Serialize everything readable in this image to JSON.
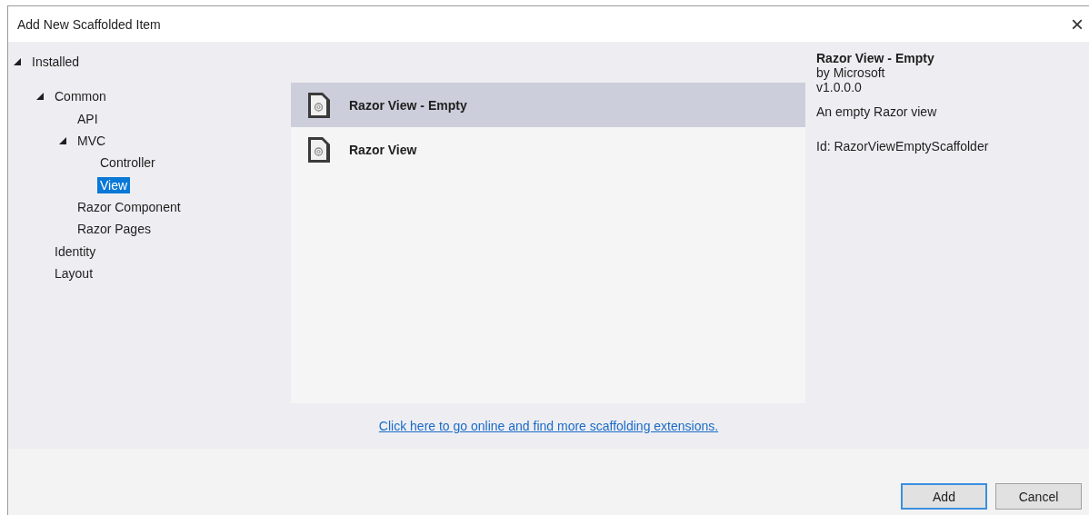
{
  "window": {
    "title": "Add New Scaffolded Item",
    "close": "×"
  },
  "tree": [
    {
      "label": "Installed",
      "expanded": true,
      "selected": false,
      "children": [
        {
          "label": "Common",
          "expanded": true,
          "selected": false,
          "children": [
            {
              "label": "API",
              "selected": false
            },
            {
              "label": "MVC",
              "expanded": true,
              "selected": false,
              "children": [
                {
                  "label": "Controller",
                  "selected": false
                },
                {
                  "label": "View",
                  "selected": true
                }
              ]
            },
            {
              "label": "Razor Component",
              "selected": false
            },
            {
              "label": "Razor Pages",
              "selected": false
            }
          ]
        },
        {
          "label": "Identity",
          "selected": false
        },
        {
          "label": "Layout",
          "selected": false
        }
      ]
    }
  ],
  "templates": [
    {
      "name": "Razor View - Empty",
      "selected": true
    },
    {
      "name": "Razor View",
      "selected": false
    }
  ],
  "details": {
    "title": "Razor View - Empty",
    "author": "by Microsoft",
    "version": "v1.0.0.0",
    "description": "An empty Razor view",
    "id": "Id: RazorViewEmptyScaffolder"
  },
  "online_link": "Click here to go online and find more scaffolding extensions.",
  "buttons": [
    {
      "label": "Add",
      "default": true
    },
    {
      "label": "Cancel",
      "default": false
    }
  ]
}
